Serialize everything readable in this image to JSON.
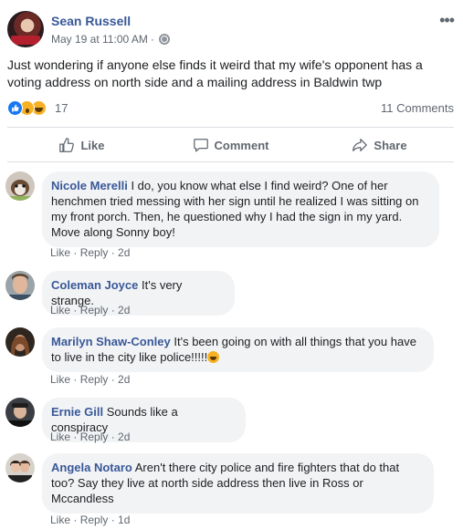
{
  "post": {
    "author": "Sean Russell",
    "timestamp": "May 19 at 11:00 AM",
    "separator": "·",
    "privacy_icon": "globe-icon",
    "text": "Just wondering if anyone else finds it weird that my wife's opponent has a voting address on north side and a mailing address in Baldwin twp",
    "reaction_count": "17",
    "reaction_icons": [
      "like-icon",
      "wow-icon",
      "haha-icon"
    ],
    "comment_count": "11 Comments",
    "more_icon": "•••"
  },
  "actions": {
    "like": "Like",
    "comment": "Comment",
    "share": "Share"
  },
  "comments": [
    {
      "name": "Nicole Merelli",
      "text": "I do, you know what else I find weird? One of her henchmen tried messing with her sign until he realized I was sitting on my front porch. Then, he questioned why I had the sign in my yard. Move along Sonny boy!",
      "like": "Like",
      "reply": "Reply",
      "age": "2d"
    },
    {
      "name": "Coleman Joyce",
      "text": "It's very strange.",
      "like": "Like",
      "reply": "Reply",
      "age": "2d"
    },
    {
      "name": "Marilyn Shaw-Conley",
      "text": "It's been going on with all things that you have to live in the city like police!!!!!",
      "like": "Like",
      "reply": "Reply",
      "age": "2d"
    },
    {
      "name": "Ernie Gill",
      "text": "Sounds like a conspiracy",
      "like": "Like",
      "reply": "Reply",
      "age": "2d"
    },
    {
      "name": "Angela Notaro",
      "text": "Aren't there city police and fire fighters that do that too? Say they live at north side address then live in Ross or Mccandless",
      "like": "Like",
      "reply": "Reply",
      "age": "1d"
    }
  ],
  "colors": {
    "link_blue": "#385898",
    "meta_gray": "#606770",
    "bubble_bg": "#f2f3f5",
    "like_blue": "#1877f2",
    "emoji_yellow": "#f7b125"
  }
}
